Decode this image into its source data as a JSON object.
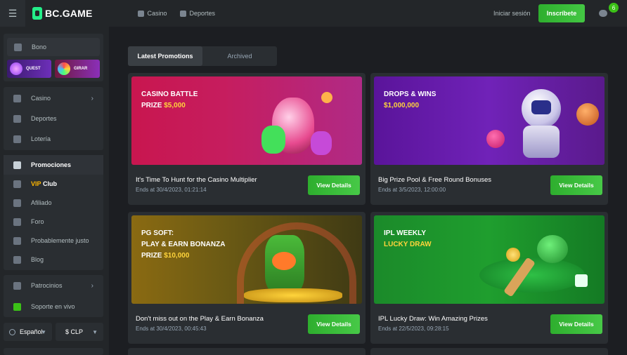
{
  "header": {
    "brand": "BC.GAME",
    "nav": [
      {
        "label": "Casino",
        "icon": "casino-icon"
      },
      {
        "label": "Deportes",
        "icon": "sports-icon"
      }
    ],
    "login_label": "Iniciar sesión",
    "signup_label": "Inscríbete",
    "chat_badge": "6"
  },
  "sidebar": {
    "bono_label": "Bono",
    "quest_label": "QUEST",
    "girar_label": "GIRAR",
    "items": [
      {
        "label": "Casino",
        "icon": "casino-icon"
      },
      {
        "label": "Deportes",
        "icon": "sports-icon"
      },
      {
        "label": "Lotería",
        "icon": "lottery-icon"
      },
      {
        "label": "Promociones",
        "icon": "gift-icon"
      },
      {
        "label_gold": "VIP",
        "label_white": "Club",
        "icon": "crown-icon"
      },
      {
        "label": "Afiliado",
        "icon": "affiliate-icon"
      },
      {
        "label": "Foro",
        "icon": "forum-icon"
      },
      {
        "label": "Probablemente justo",
        "icon": "shield-icon"
      },
      {
        "label": "Blog",
        "icon": "blog-icon"
      },
      {
        "label": "Patrocinios",
        "icon": "handshake-icon"
      },
      {
        "label": "Soporte en vivo",
        "icon": "headset-icon"
      }
    ],
    "language": "Español",
    "currency": "$ CLP"
  },
  "tabs": [
    {
      "label": "Latest Promotions",
      "active": true
    },
    {
      "label": "Archived",
      "active": false
    }
  ],
  "promotions": [
    {
      "banner_line1": "CASINO BATTLE",
      "banner_line2_prefix": "PRIZE ",
      "banner_line2_value": "$5,000",
      "title": "It's Time To Hunt for the Casino Multiplier",
      "ends": "Ends at 30/4/2023, 01:21:14",
      "button": "View Details"
    },
    {
      "banner_line1": "DROPS & WINS",
      "banner_line2_value": "$1,000,000",
      "title": "Big Prize Pool & Free Round Bonuses",
      "ends": "Ends at 3/5/2023, 12:00:00",
      "button": "View Details"
    },
    {
      "banner_line1": "PG SOFT:",
      "banner_line2": "PLAY & EARN BONANZA",
      "banner_line3_prefix": "PRIZE ",
      "banner_line3_value": "$10,000",
      "title": "Don't miss out on the Play & Earn Bonanza",
      "ends": "Ends at 30/4/2023, 00:45:43",
      "button": "View Details"
    },
    {
      "banner_line1": "IPL WEEKLY",
      "banner_line2_value": "LUCKY DRAW",
      "title": "IPL Lucky Draw: Win Amazing Prizes",
      "ends": "Ends at 22/5/2023, 09:28:15",
      "button": "View Details"
    }
  ],
  "colors": {
    "accent_green": "#3bc117",
    "gold": "#ffd43b",
    "background": "#1c1e22"
  }
}
